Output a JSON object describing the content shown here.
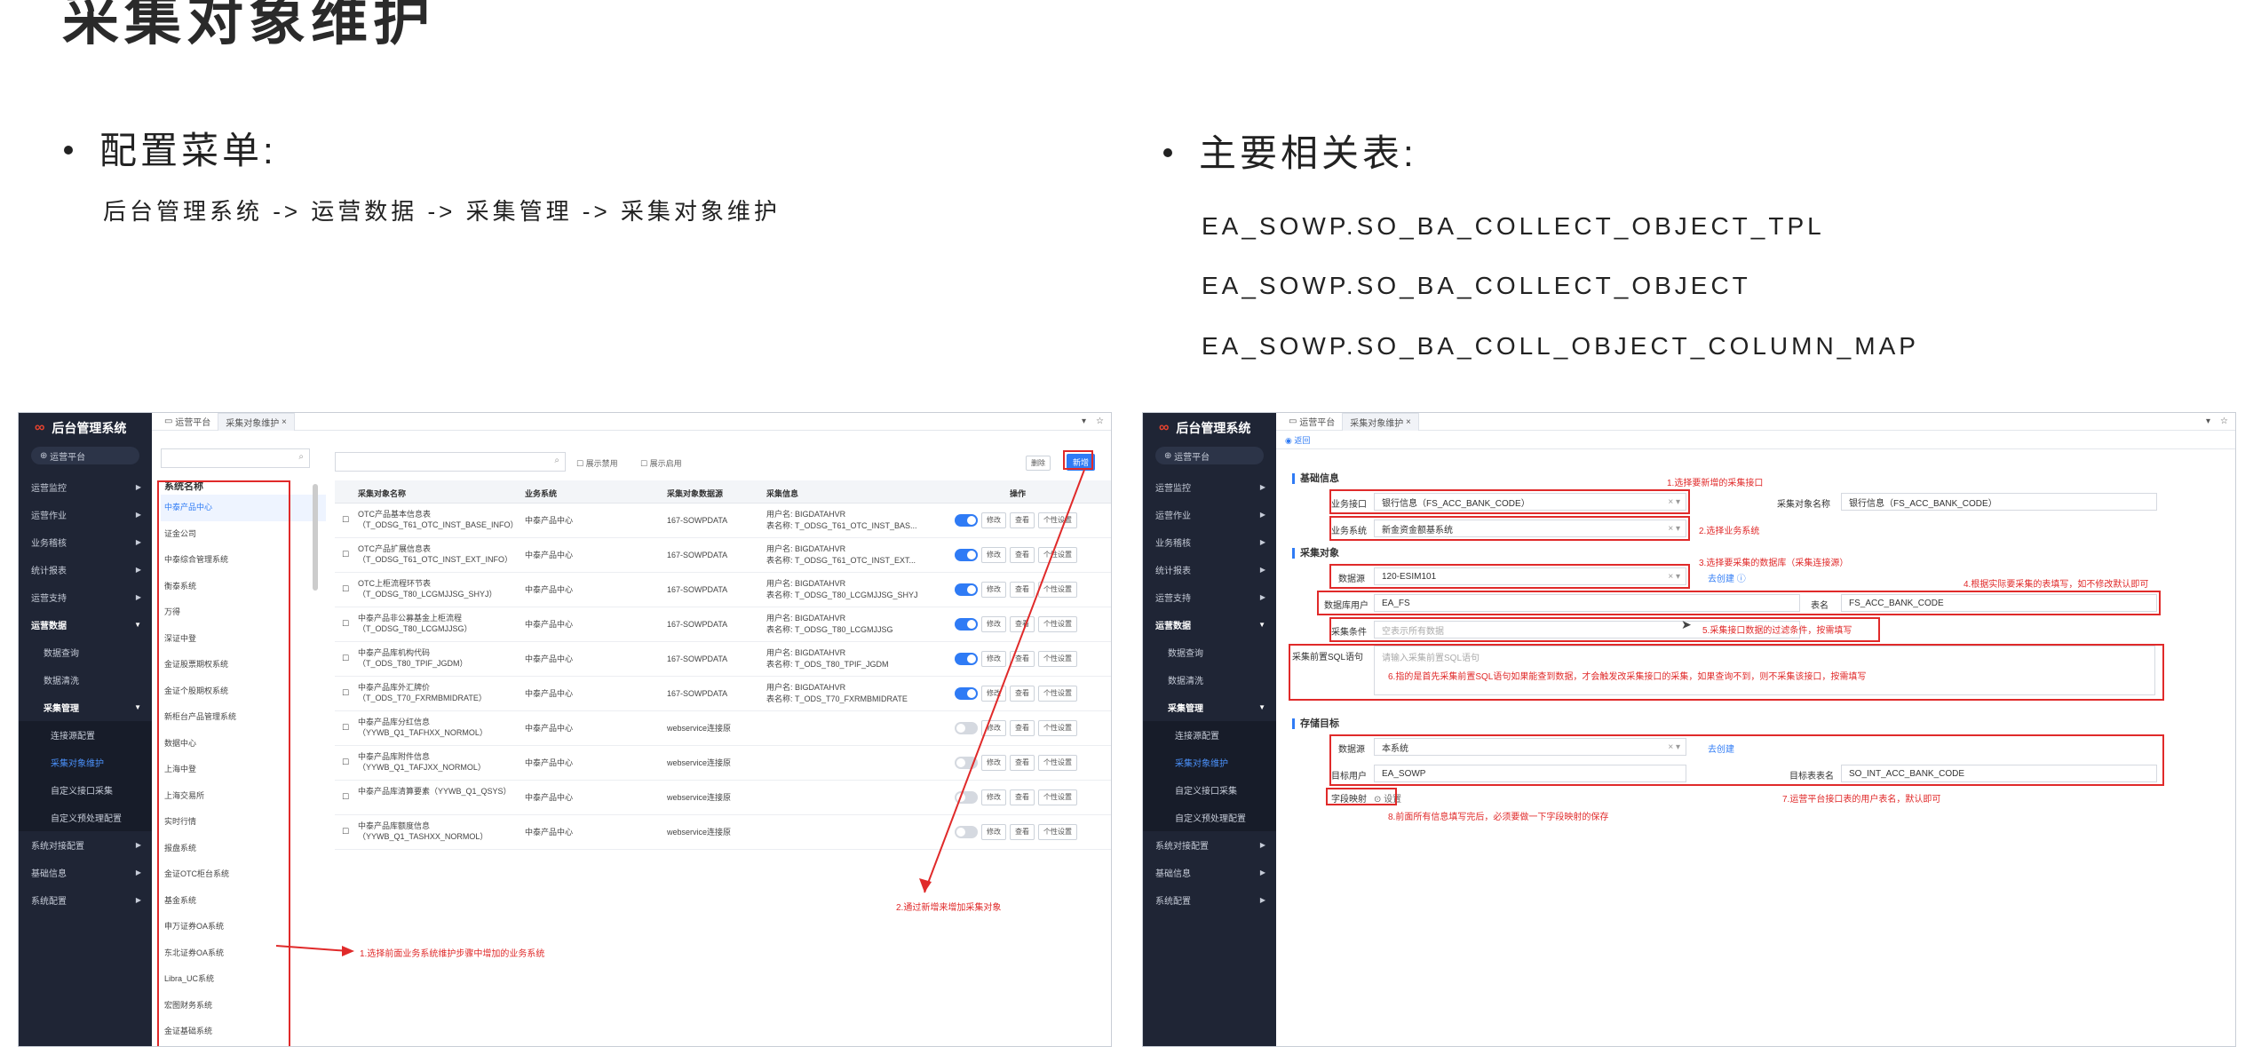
{
  "slide": {
    "title": "采集对象维护",
    "menu_heading": "配置菜单:",
    "menu_path": "后台管理系统 -> 运营数据 -> 采集管理 -> 采集对象维护",
    "tables_heading": "主要相关表:",
    "tables": [
      "EA_SOWP.SO_BA_COLLECT_OBJECT_TPL",
      "EA_SOWP.SO_BA_COLLECT_OBJECT",
      "EA_SOWP.SO_BA_COLL_OBJECT_COLUMN_MAP"
    ]
  },
  "app": {
    "logo_name": "后台管理系统",
    "platform": "运营平台",
    "home_tab": "运营平台",
    "current_tab": "采集对象维护",
    "sidebar": [
      {
        "label": "运营监控",
        "kind": "top"
      },
      {
        "label": "运营作业",
        "kind": "top"
      },
      {
        "label": "业务稽核",
        "kind": "top"
      },
      {
        "label": "统计报表",
        "kind": "top"
      },
      {
        "label": "运营支持",
        "kind": "top"
      },
      {
        "label": "运营数据",
        "kind": "open"
      },
      {
        "label": "数据查询",
        "kind": "sub"
      },
      {
        "label": "数据清洗",
        "kind": "sub"
      },
      {
        "label": "采集管理",
        "kind": "subopen"
      },
      {
        "label": "连接源配置",
        "kind": "sub2"
      },
      {
        "label": "采集对象维护",
        "kind": "sub2active"
      },
      {
        "label": "自定义接口采集",
        "kind": "sub2"
      },
      {
        "label": "自定义预处理配置",
        "kind": "sub2"
      },
      {
        "label": "系统对接配置",
        "kind": "top"
      },
      {
        "label": "基础信息",
        "kind": "top"
      },
      {
        "label": "系统配置",
        "kind": "top"
      }
    ]
  },
  "left_shot": {
    "system_list_header": "系统名称",
    "systems": [
      "中泰产品中心",
      "证金公司",
      "中泰综合管理系统",
      "衡泰系统",
      "万得",
      "深证中登",
      "金证股票期权系统",
      "金证个股期权系统",
      "新柜台产品管理系统",
      "数据中心",
      "上海中登",
      "上海交易所",
      "实时行情",
      "报盘系统",
      "金证OTC柜台系统",
      "基金系统",
      "申万证券OA系统",
      "东北证券OA系统",
      "Libra_UC系统",
      "宏图财务系统",
      "金证基础系统"
    ],
    "checkbox1": "展示禁用",
    "checkbox2": "展示启用",
    "delete_btn": "删除",
    "add_btn": "新增",
    "columns": [
      "采集对象名称",
      "业务系统",
      "采集对象数据源",
      "采集信息",
      "操作"
    ],
    "row_actions": [
      "修改",
      "查看",
      "个性设置"
    ],
    "rows": [
      {
        "name": "OTC产品基本信息表（T_ODSG_T61_OTC_INST_BASE_INFO）",
        "sys": "中泰产品中心",
        "src": "167-SOWPDATA",
        "info1": "用户名: BIGDATAHVR",
        "info2": "表名称: T_ODSG_T61_OTC_INST_BAS...",
        "on": true
      },
      {
        "name": "OTC产品扩展信息表（T_ODSG_T61_OTC_INST_EXT_INFO）",
        "sys": "中泰产品中心",
        "src": "167-SOWPDATA",
        "info1": "用户名: BIGDATAHVR",
        "info2": "表名称: T_ODSG_T61_OTC_INST_EXT...",
        "on": true
      },
      {
        "name": "OTC上柜流程环节表（T_ODSG_T80_LCGMJJSG_SHYJ）",
        "sys": "中泰产品中心",
        "src": "167-SOWPDATA",
        "info1": "用户名: BIGDATAHVR",
        "info2": "表名称: T_ODSG_T80_LCGMJJSG_SHYJ",
        "on": true
      },
      {
        "name": "中泰产品非公募基金上柜流程（T_ODSG_T80_LCGMJJSG）",
        "sys": "中泰产品中心",
        "src": "167-SOWPDATA",
        "info1": "用户名: BIGDATAHVR",
        "info2": "表名称: T_ODSG_T80_LCGMJJSG",
        "on": true
      },
      {
        "name": "中泰产品库机构代码（T_ODS_T80_TPIF_JGDM）",
        "sys": "中泰产品中心",
        "src": "167-SOWPDATA",
        "info1": "用户名: BIGDATAHVR",
        "info2": "表名称: T_ODS_T80_TPIF_JGDM",
        "on": true
      },
      {
        "name": "中泰产品库外汇牌价（T_ODS_T70_FXRMBMIDRATE）",
        "sys": "中泰产品中心",
        "src": "167-SOWPDATA",
        "info1": "用户名: BIGDATAHVR",
        "info2": "表名称: T_ODS_T70_FXRMBMIDRATE",
        "on": true
      },
      {
        "name": "中泰产品库分红信息（YYWB_Q1_TAFHXX_NORMOL）",
        "sys": "中泰产品中心",
        "src": "webservice连接原",
        "info1": "",
        "info2": "",
        "on": false
      },
      {
        "name": "中泰产品库附件信息（YYWB_Q1_TAFJXX_NORMOL）",
        "sys": "中泰产品中心",
        "src": "webservice连接原",
        "info1": "",
        "info2": "",
        "on": false
      },
      {
        "name": "中泰产品库清算要素（YYWB_Q1_QSYS）",
        "sys": "中泰产品中心",
        "src": "webservice连接原",
        "info1": "",
        "info2": "",
        "on": false
      },
      {
        "name": "中泰产品库额度信息（YYWB_Q1_TASHXX_NORMOL）",
        "sys": "中泰产品中心",
        "src": "webservice连接原",
        "info1": "",
        "info2": "",
        "on": false
      }
    ],
    "note1": "1.选择前面业务系统维护步骤中增加的业务系统",
    "note2": "2.通过新增来增加采集对象"
  },
  "right_shot": {
    "back": "返回",
    "sec_basic": "基础信息",
    "lbl_interface": "业务接口",
    "val_interface": "银行信息（FS_ACC_BANK_CODE）",
    "lbl_objname": "采集对象名称",
    "val_objname": "银行信息（FS_ACC_BANK_CODE）",
    "lbl_bizsys": "业务系统",
    "val_bizsys": "新金资金额基系统",
    "sec_object": "采集对象",
    "lbl_ds": "数据源",
    "val_ds": "120-ESIM101",
    "link_create": "去创建",
    "lbl_dbuser": "数据库用户",
    "val_dbuser": "EA_FS",
    "lbl_tablename": "表名",
    "val_tablename": "FS_ACC_BANK_CODE",
    "lbl_cond": "采集条件",
    "ph_cond": "空表示所有数据",
    "lbl_presql": "采集前置SQL语句",
    "ph_presql": "请输入采集前置SQL语句",
    "sec_target": "存储目标",
    "lbl_tds": "数据源",
    "val_tds": "本系统",
    "link_create2": "去创建",
    "lbl_tuser": "目标用户",
    "val_tuser": "EA_SOWP",
    "lbl_ttable": "目标表表名",
    "val_ttable": "SO_INT_ACC_BANK_CODE",
    "lbl_map": "字段映射",
    "btn_map": "设置",
    "notes": {
      "n1": "1.选择要新增的采集接口",
      "n2": "2.选择业务系统",
      "n3": "3.选择要采集的数据库（采集连接源）",
      "n4": "4.根据实际要采集的表填写，如不修改默认即可",
      "n5": "5.采集接口数据的过滤条件，按需填写",
      "n6": "6.指的是首先采集前置SQL语句如果能查到数据，才会触发改采集接口的采集，如果查询不到，则不采集该接口，按需填写",
      "n7": "7.运营平台接口表的用户表名，默认即可",
      "n8": "8.前面所有信息填写完后，必须要做一下字段映射的保存"
    }
  },
  "colors": {
    "accent": "#2f7bf5",
    "annotation": "#e02a2a",
    "sidebar": "#1f2535"
  },
  "icons": [
    "monitor-icon",
    "close-icon",
    "search-icon",
    "chevron-down-icon",
    "star-icon",
    "chevron-right-icon",
    "cursor-icon",
    "arrow-icon"
  ]
}
